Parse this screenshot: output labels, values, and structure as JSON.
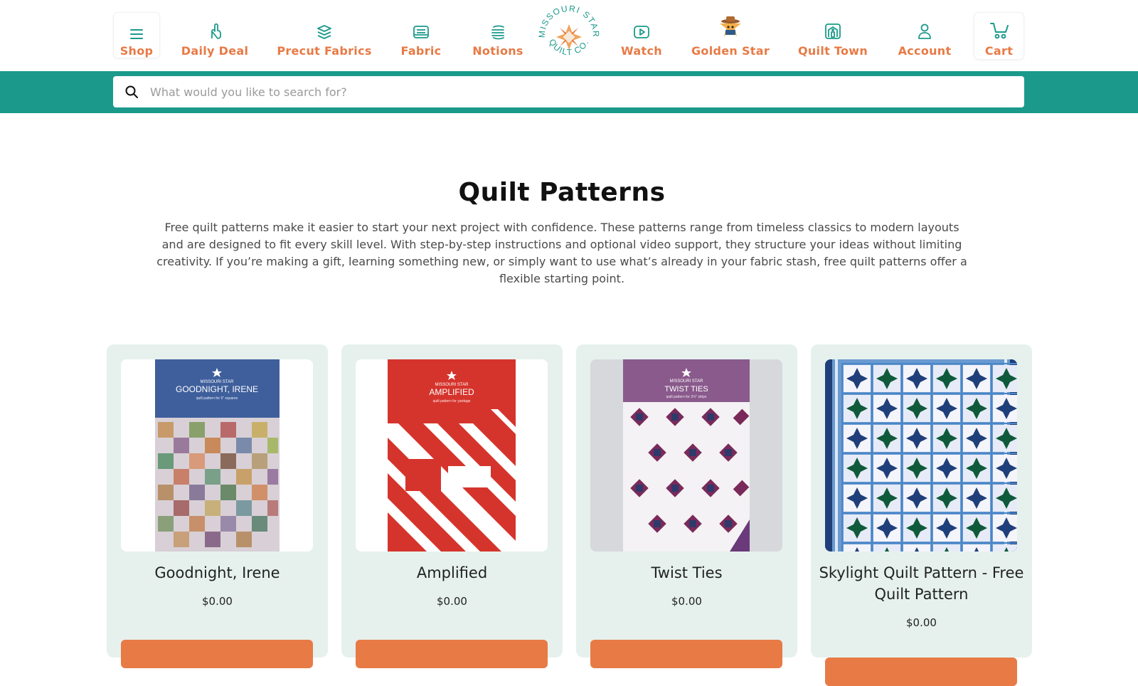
{
  "brand": {
    "name": "Missouri Star Quilt Co.",
    "primary_color": "#1b9a8c",
    "accent_color": "#e87a45"
  },
  "nav": {
    "items": [
      {
        "label": "Shop",
        "icon": "hamburger-menu-icon"
      },
      {
        "label": "Daily Deal",
        "icon": "pointing-hand-icon"
      },
      {
        "label": "Precut Fabrics",
        "icon": "stacked-layers-icon"
      },
      {
        "label": "Fabric",
        "icon": "fabric-bolt-icon"
      },
      {
        "label": "Notions",
        "icon": "thread-spool-icon"
      },
      {
        "label": "Watch",
        "icon": "play-video-icon"
      },
      {
        "label": "Golden Star",
        "icon": "golden-star-mascot-icon"
      },
      {
        "label": "Quilt Town",
        "icon": "quilt-town-house-icon"
      },
      {
        "label": "Account",
        "icon": "user-icon"
      },
      {
        "label": "Cart",
        "icon": "cart-icon"
      }
    ]
  },
  "search": {
    "placeholder": "What would you like to search for?",
    "value": ""
  },
  "page": {
    "title": "Quilt Patterns",
    "description": "Free quilt patterns make it easier to start your next project with confidence. These patterns range from timeless classics to modern layouts and are designed to fit every skill level. With step-by-step instructions and optional video support, they structure your ideas without limiting creativity. If you’re making a gift, learning something new, or simply want to use what’s already in your fabric stash, free quilt patterns offer a flexible starting point."
  },
  "products": [
    {
      "name": "Goodnight, Irene",
      "price": "$0.00",
      "cover_title": "GOODNIGHT, IRENE",
      "cover_subtitle": "quilt pattern for 5\" squares",
      "cover_brand": "MISSOURI STAR",
      "cover_color": "#3f5f9c"
    },
    {
      "name": "Amplified",
      "price": "$0.00",
      "cover_title": "AMPLIFIED",
      "cover_subtitle": "quilt pattern for yardage",
      "cover_brand": "MISSOURI STAR",
      "cover_color": "#d5342c"
    },
    {
      "name": "Twist Ties",
      "price": "$0.00",
      "cover_title": "TWIST TIES",
      "cover_subtitle": "quilt pattern for 2½\" strips",
      "cover_brand": "MISSOURI STAR",
      "cover_color": "#8a5a8c"
    },
    {
      "name": "Skylight Quilt Pattern - Free Quilt Pattern",
      "price": "$0.00",
      "cover_title": "",
      "cover_subtitle": "",
      "cover_brand": "",
      "cover_color": "#2f6bb3"
    }
  ]
}
